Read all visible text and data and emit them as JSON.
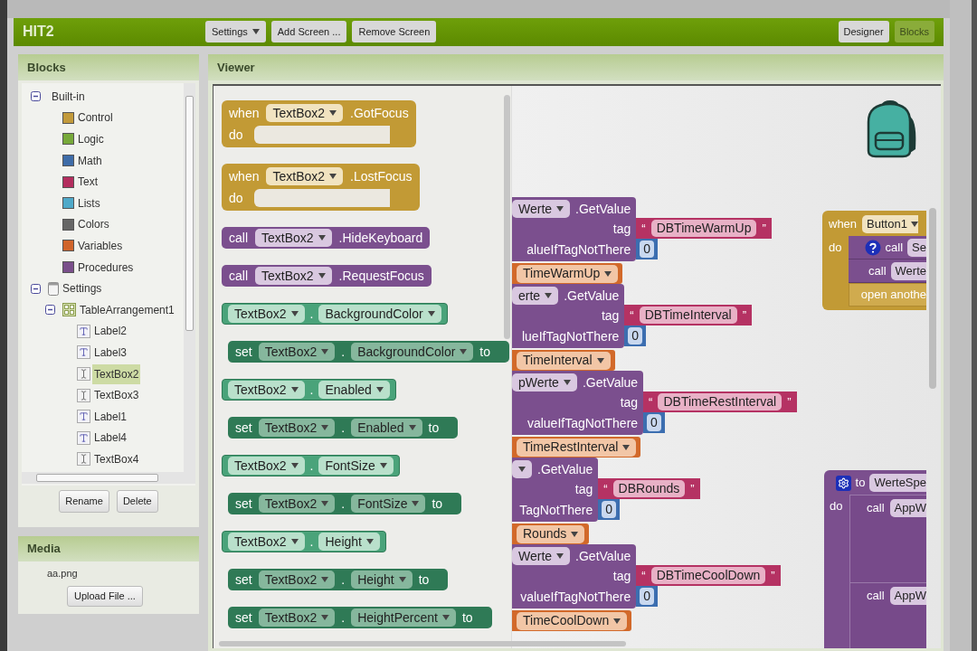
{
  "app_bar": {
    "title": "HIT2",
    "buttons": [
      {
        "label": "Settings",
        "dropdown": true
      },
      {
        "label": "Add Screen ...",
        "dropdown": false
      },
      {
        "label": "Remove Screen",
        "dropdown": false
      }
    ],
    "views": [
      {
        "label": "Designer",
        "selected": false
      },
      {
        "label": "Blocks",
        "selected": true
      }
    ]
  },
  "blocks_panel": {
    "title": "Blocks",
    "tree": [
      {
        "label": "Built-in",
        "kind": "builtin",
        "expanded": true,
        "selected": false,
        "children": [
          {
            "label": "Control",
            "kind": "category",
            "color": "#c29a3b",
            "selected": false
          },
          {
            "label": "Logic",
            "kind": "category",
            "color": "#77a93a",
            "selected": false
          },
          {
            "label": "Math",
            "kind": "category",
            "color": "#3e6ca8",
            "selected": false
          },
          {
            "label": "Text",
            "kind": "category",
            "color": "#b32d5e",
            "selected": false
          },
          {
            "label": "Lists",
            "kind": "category",
            "color": "#4fa9c9",
            "selected": false
          },
          {
            "label": "Colors",
            "kind": "category",
            "color": "#666666",
            "selected": false
          },
          {
            "label": "Variables",
            "kind": "category",
            "color": "#d0642b",
            "selected": false
          },
          {
            "label": "Procedures",
            "kind": "category",
            "color": "#7a4f8b",
            "selected": false
          }
        ]
      },
      {
        "label": "Settings",
        "kind": "screen",
        "expanded": true,
        "selected": false,
        "children": [
          {
            "label": "TableArrangement1",
            "kind": "arrangement",
            "expanded": true,
            "selected": false,
            "children": [
              {
                "label": "Label2",
                "kind": "label",
                "selected": false
              },
              {
                "label": "Label3",
                "kind": "label",
                "selected": false
              },
              {
                "label": "TextBox2",
                "kind": "textbox",
                "selected": true
              },
              {
                "label": "TextBox3",
                "kind": "textbox",
                "selected": false
              },
              {
                "label": "Label1",
                "kind": "label",
                "selected": false
              },
              {
                "label": "Label4",
                "kind": "label",
                "selected": false
              },
              {
                "label": "TextBox4",
                "kind": "textbox",
                "selected": false
              }
            ]
          }
        ]
      }
    ],
    "buttons": [
      "Rename",
      "Delete"
    ]
  },
  "media_panel": {
    "title": "Media",
    "files": [
      "aa.png"
    ],
    "upload_button": "Upload File ..."
  },
  "viewer": {
    "title": "Viewer",
    "flyout": [
      {
        "kind": "event",
        "keyword": "when",
        "component": "TextBox2",
        "event": ".GotFocus",
        "do": "do"
      },
      {
        "kind": "event",
        "keyword": "when",
        "component": "TextBox2",
        "event": ".LostFocus",
        "do": "do"
      },
      {
        "kind": "method",
        "keyword": "call",
        "component": "TextBox2",
        "method": ".HideKeyboard"
      },
      {
        "kind": "method",
        "keyword": "call",
        "component": "TextBox2",
        "method": ".RequestFocus"
      },
      {
        "kind": "getter",
        "component": "TextBox2",
        "dot": ".",
        "property": "BackgroundColor"
      },
      {
        "kind": "setter",
        "keyword": "set",
        "component": "TextBox2",
        "dot": ".",
        "property": "BackgroundColor",
        "to": "to"
      },
      {
        "kind": "getter",
        "component": "TextBox2",
        "dot": ".",
        "property": "Enabled"
      },
      {
        "kind": "setter",
        "keyword": "set",
        "component": "TextBox2",
        "dot": ".",
        "property": "Enabled",
        "to": "to"
      },
      {
        "kind": "getter",
        "component": "TextBox2",
        "dot": ".",
        "property": "FontSize"
      },
      {
        "kind": "setter",
        "keyword": "set",
        "component": "TextBox2",
        "dot": ".",
        "property": "FontSize",
        "to": "to"
      },
      {
        "kind": "getter",
        "component": "TextBox2",
        "dot": ".",
        "property": "Height"
      },
      {
        "kind": "setter",
        "keyword": "set",
        "component": "TextBox2",
        "dot": ".",
        "property": "Height",
        "to": "to"
      },
      {
        "kind": "setter",
        "keyword": "set",
        "component": "TextBox2",
        "dot": ".",
        "property": "HeightPercent",
        "to": "to"
      }
    ],
    "getvalue_blocks": [
      {
        "component": "Werte",
        "method": ".GetValue",
        "tag_label": "tag",
        "quote_open": "“",
        "tag": "DBTimeWarmUp",
        "quote_close": "”",
        "default_label": "alueIfTagNotThere",
        "default": "0",
        "variable": "TimeWarmUp"
      },
      {
        "component": "erte",
        "method": ".GetValue",
        "tag_label": "tag",
        "quote_open": "“",
        "tag": "DBTimeInterval",
        "quote_close": "”",
        "default_label": "lueIfTagNotThere",
        "default": "0",
        "variable": "TimeInterval"
      },
      {
        "component": "pWerte",
        "method": ".GetValue",
        "tag_label": "tag",
        "quote_open": "“",
        "tag": "DBTimeRestInterval",
        "quote_close": "”",
        "default_label": "valueIfTagNotThere",
        "default": "0",
        "variable": "TimeRestInterval"
      },
      {
        "method": ".GetValue",
        "tag_label": "tag",
        "quote_open": "“",
        "tag": "DBRounds",
        "quote_close": "”",
        "default_label": "TagNotThere",
        "default": "0",
        "variable": "Rounds"
      },
      {
        "component": "Werte",
        "method": ".GetValue",
        "tag_label": "tag",
        "quote_open": "“",
        "tag": "DBTimeCoolDown",
        "quote_close": "”",
        "default_label": "valueIfTagNotThere",
        "default": "0",
        "variable": "TimeCoolDown"
      }
    ],
    "event_block": {
      "keyword": "when",
      "component": "Button1",
      "do": "do",
      "statements": [
        {
          "kind": "call",
          "help": true,
          "keyword": "call",
          "component": "Se"
        },
        {
          "kind": "call",
          "help": false,
          "keyword": "call",
          "component": "Werte"
        },
        {
          "kind": "control",
          "text": "open anothe"
        }
      ]
    },
    "procedure_block": {
      "keyword": "to",
      "name": "WerteSpe",
      "do": "do",
      "statements": [
        {
          "keyword": "call",
          "component": "AppW"
        },
        {
          "keyword": "call",
          "component": "AppW"
        }
      ]
    }
  }
}
